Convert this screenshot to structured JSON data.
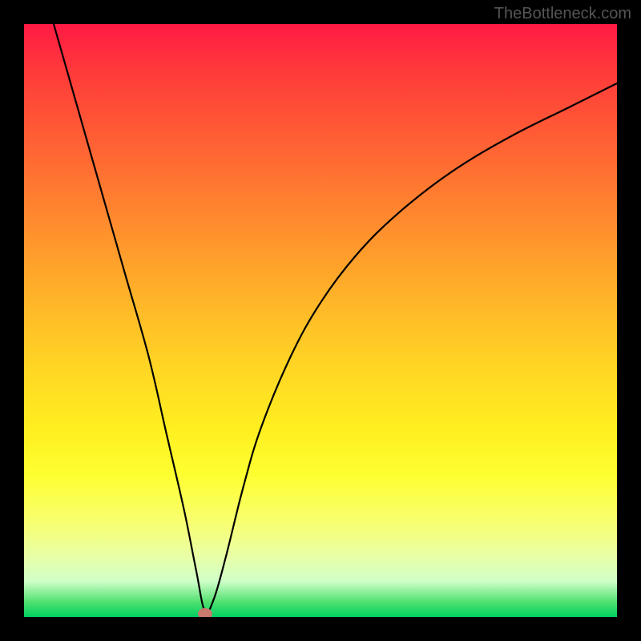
{
  "watermark": "TheBottleneck.com",
  "chart_data": {
    "type": "line",
    "title": "",
    "xlabel": "",
    "ylabel": "",
    "xlim": [
      0,
      100
    ],
    "ylim": [
      0,
      100
    ],
    "series": [
      {
        "name": "bottleneck-curve",
        "x": [
          5,
          9,
          13,
          17,
          21,
          24,
          27,
          29,
          30.5,
          32,
          34,
          37,
          40,
          45,
          50,
          56,
          63,
          72,
          82,
          92,
          100
        ],
        "values": [
          100,
          86,
          72,
          58,
          44,
          31,
          18,
          8,
          1,
          3,
          10,
          22,
          32,
          44,
          53,
          61,
          68,
          75,
          81,
          86,
          90
        ]
      }
    ],
    "annotations": [
      {
        "name": "minimum-marker",
        "x": 30.5,
        "y": 0.5
      }
    ],
    "background_gradient": {
      "top": "#ff1a44",
      "middle": "#ffee20",
      "bottom": "#00d060"
    }
  }
}
